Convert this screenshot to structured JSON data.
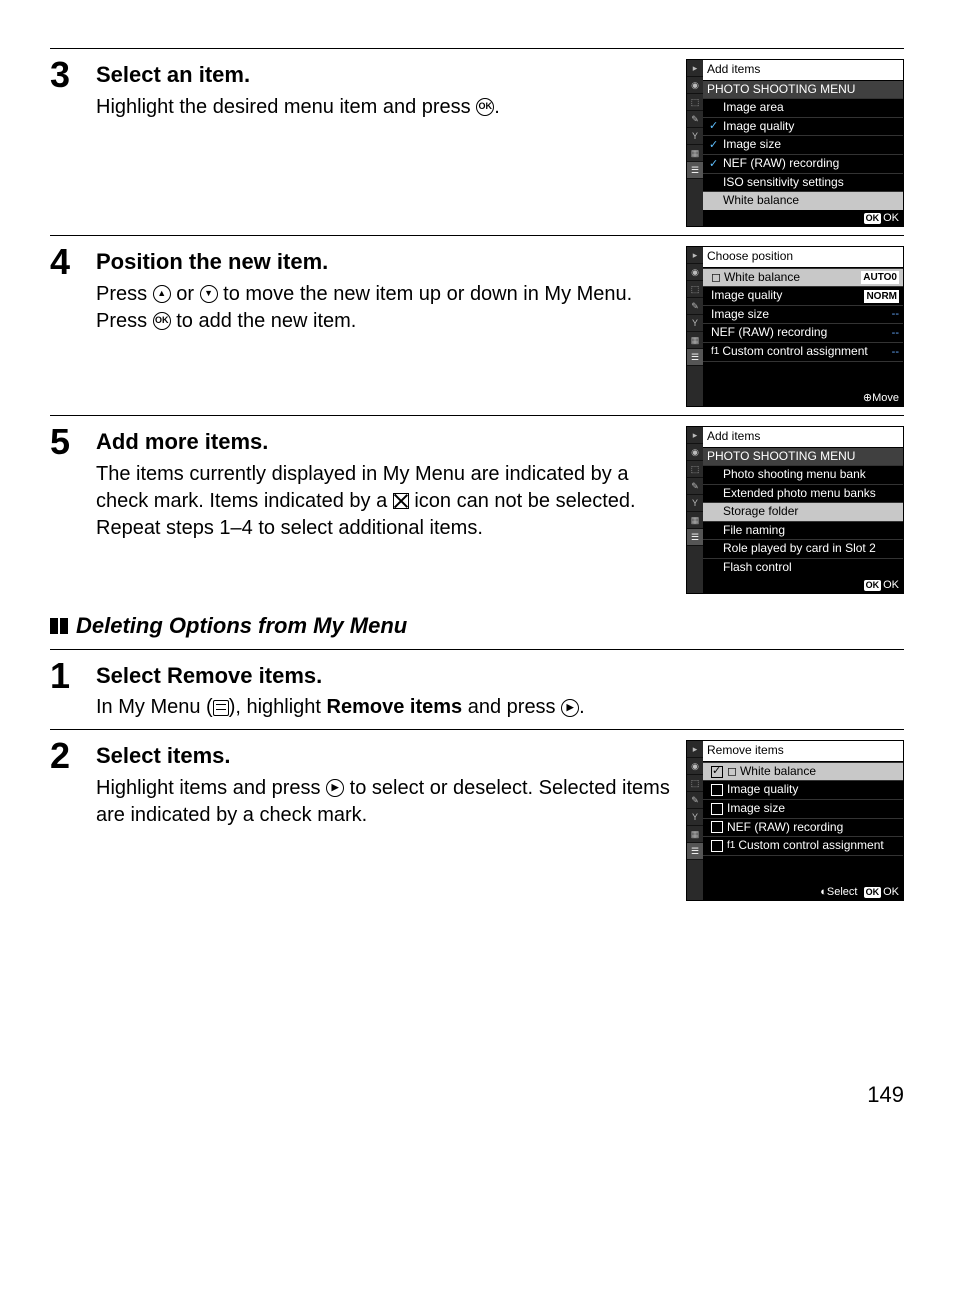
{
  "page_number": "149",
  "steps_a": [
    {
      "num": "3",
      "title": "Select an item.",
      "text_before": "Highlight the desired menu item and press ",
      "text_after": "."
    },
    {
      "num": "4",
      "title": "Position the new item.",
      "text_p1": "Press ",
      "text_p2": " or ",
      "text_p3": " to move the new item up or down in My Menu.  Press ",
      "text_p4": " to add the new item."
    },
    {
      "num": "5",
      "title": "Add more items.",
      "text_p1": "The items currently displayed in My Menu are indicated by a check mark.  Items indicated by a ",
      "text_p2": " icon can not be selected.  Repeat steps 1–4 to select additional items."
    }
  ],
  "subheading": "Deleting Options from My Menu",
  "steps_b": [
    {
      "num": "1",
      "title_prefix": "Select ",
      "title_bold": "Remove items",
      "title_suffix": ".",
      "text_p1": "In My Menu (",
      "text_p2": "), highlight ",
      "text_bold": "Remove items",
      "text_p3": " and press ",
      "text_p4": "."
    },
    {
      "num": "2",
      "title": "Select items.",
      "text_p1": "Highlight items and press ",
      "text_p2": " to select or deselect.  Selected items are indicated by a check mark."
    }
  ],
  "lcd1": {
    "header": "Add items",
    "section": "PHOTO SHOOTING MENU",
    "rows": [
      {
        "label": "Image area",
        "check": false
      },
      {
        "label": "Image quality",
        "check": true
      },
      {
        "label": "Image size",
        "check": true
      },
      {
        "label": "NEF (RAW) recording",
        "check": true
      },
      {
        "label": "ISO sensitivity settings",
        "check": false
      },
      {
        "label": "White balance",
        "check": false,
        "highlight": true
      }
    ],
    "footer_ok": "OK",
    "footer_text": "OK"
  },
  "lcd2": {
    "header": "Choose position",
    "rows": [
      {
        "label": "White balance",
        "prefix": "◻",
        "highlight": true,
        "val": "AUTO0"
      },
      {
        "label": "Image quality",
        "val": "NORM"
      },
      {
        "label": "Image size",
        "val": "--"
      },
      {
        "label": "NEF (RAW) recording",
        "val": "--"
      },
      {
        "label": "Custom control assignment",
        "prefix": "f1",
        "val": "--"
      }
    ],
    "footer_icon": "⊕",
    "footer_text": "Move"
  },
  "lcd3": {
    "header": "Add items",
    "section": "PHOTO SHOOTING MENU",
    "rows": [
      {
        "label": "Photo shooting menu bank"
      },
      {
        "label": "Extended photo menu banks"
      },
      {
        "label": "Storage folder",
        "highlight": true
      },
      {
        "label": "File naming"
      },
      {
        "label": "Role played by card in Slot 2"
      },
      {
        "label": "Flash control"
      }
    ],
    "footer_ok": "OK",
    "footer_text": "OK"
  },
  "lcd4": {
    "header": "Remove items",
    "rows": [
      {
        "label": "White balance",
        "prefix": "◻",
        "checkbox": true,
        "checked": true,
        "highlight": true
      },
      {
        "label": "Image quality",
        "checkbox": true
      },
      {
        "label": "Image size",
        "checkbox": true
      },
      {
        "label": "NEF (RAW) recording",
        "checkbox": true
      },
      {
        "label": "Custom control assignment",
        "prefix": "f1",
        "checkbox": true
      }
    ],
    "footer_sel_icon": "◐",
    "footer_sel": "Select",
    "footer_ok": "OK",
    "footer_text": "OK"
  }
}
